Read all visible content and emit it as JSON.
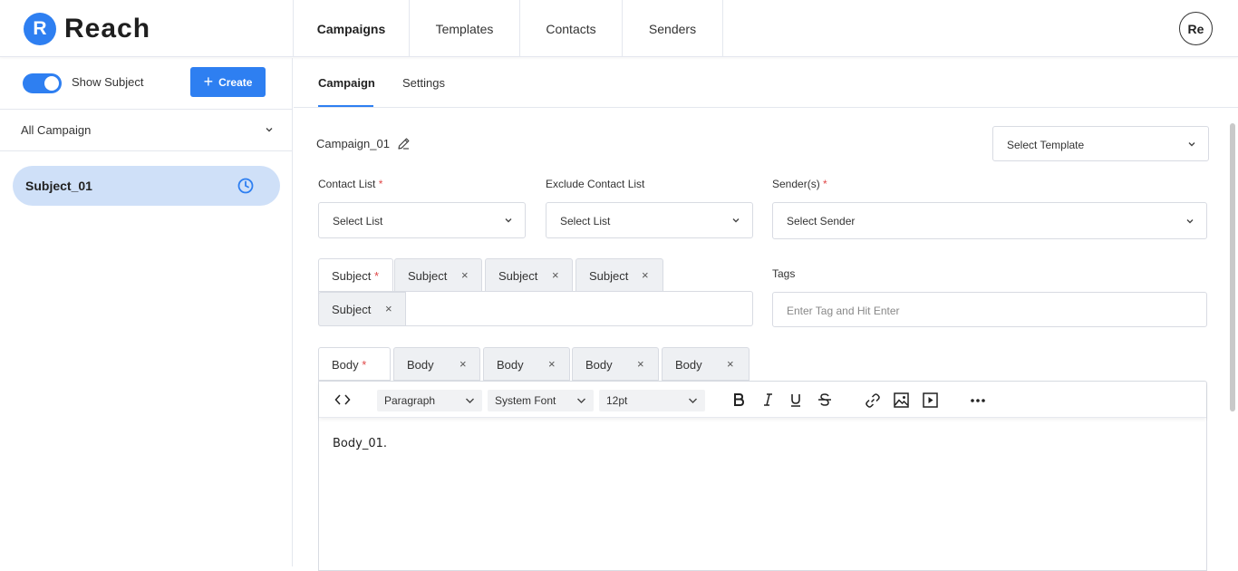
{
  "app": {
    "logo_letter": "R",
    "name": "Reach",
    "avatar_initials": "Re",
    "accent": "#2e7ff1"
  },
  "nav": [
    {
      "label": "Campaigns",
      "active": true
    },
    {
      "label": "Templates",
      "active": false
    },
    {
      "label": "Contacts",
      "active": false
    },
    {
      "label": "Senders",
      "active": false
    }
  ],
  "sidebar": {
    "toggle_label": "Show Subject",
    "toggle_on": true,
    "create_label": "Create",
    "filter_label": "All Campaign",
    "items": [
      {
        "label": "Subject_01",
        "icon": "clock-icon"
      }
    ]
  },
  "main": {
    "tabs": [
      {
        "label": "Campaign",
        "active": true
      },
      {
        "label": "Settings",
        "active": false
      }
    ],
    "campaign_name": "Campaign_01",
    "template_select": "Select Template",
    "contact_list": {
      "label": "Contact List",
      "required": "*",
      "value": "Select List"
    },
    "exclude_list": {
      "label": "Exclude Contact List",
      "value": "Select List"
    },
    "senders": {
      "label": "Sender(s)",
      "required": "*",
      "value": "Select Sender"
    },
    "subject_tabs": [
      {
        "label": "Subject",
        "required": "*"
      },
      {
        "label": "Subject",
        "close": "×"
      },
      {
        "label": "Subject",
        "close": "×"
      },
      {
        "label": "Subject",
        "close": "×"
      },
      {
        "label": "Subject",
        "close": "×"
      }
    ],
    "tags": {
      "label": "Tags",
      "placeholder": "Enter Tag and Hit Enter"
    },
    "body_tabs": [
      {
        "label": "Body",
        "required": "*"
      },
      {
        "label": "Body",
        "close": "×"
      },
      {
        "label": "Body",
        "close": "×"
      },
      {
        "label": "Body",
        "close": "×"
      },
      {
        "label": "Body",
        "close": "×"
      }
    ],
    "editor": {
      "block_format": "Paragraph",
      "font_family": "System Font",
      "font_size": "12pt",
      "content": "Body_01."
    }
  }
}
